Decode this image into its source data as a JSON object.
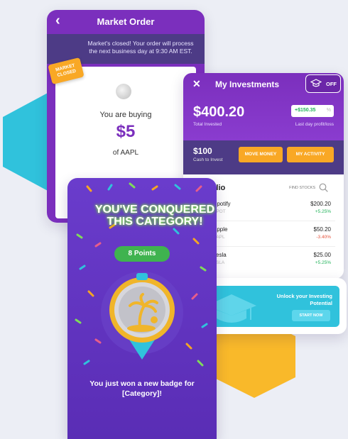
{
  "colors": {
    "purple": "#7b2fbd",
    "deep_purple": "#4d3b86",
    "yellow": "#f9a825",
    "teal": "#30c2dc",
    "green": "#3fb34f",
    "positive": "#21b35a",
    "negative": "#e5533d"
  },
  "market_order": {
    "title": "Market Order",
    "back_icon": "chevron-left-icon",
    "notice": "Market's closed! Your order will process the next business day at 9:30 AM EST.",
    "badge": "MARKET CLOSED",
    "buying_label": "You are buying",
    "amount": "$5",
    "of_label": "of AAPL"
  },
  "investments": {
    "title": "My Investments",
    "close_icon": "close-icon",
    "toggle_icon": "graduation-cap-icon",
    "toggle_label": "OFF",
    "total_amount": "$400.20",
    "total_label": "Total Invested",
    "change_value": "+$150.35",
    "change_label": "Last day profit/loss",
    "cash_amount": "$100",
    "cash_label": "Cash to Invest",
    "move_money_label": "MOVE MONEY",
    "my_activity_label": "MY ACTIVITY",
    "portfolio_title": "Portfolio",
    "find_stocks_label": "FIND STOCKS",
    "stocks": [
      {
        "name": "Spotify",
        "ticker": "SPOT",
        "price": "$200.20",
        "change": "+5.25%",
        "positive": true
      },
      {
        "name": "Apple",
        "ticker": "AAPL",
        "price": "$50.20",
        "change": "-3.40%",
        "positive": false
      },
      {
        "name": "Tesla",
        "ticker": "TSLA",
        "price": "$25.00",
        "change": "+5.25%",
        "positive": true
      }
    ]
  },
  "unlock": {
    "text_line1": "Unlock your Investing",
    "text_line2": "Potential",
    "button_label": "START NOW",
    "icon": "graduation-cap-icon"
  },
  "conquer": {
    "title_line1": "YOU'VE CONQUERED",
    "title_line2": "THIS CATEGORY!",
    "points": "8 Points",
    "medal_icon": "palm-tree-medal-icon",
    "message_line1": "You just won a new badge for",
    "message_line2": "[Category]!"
  }
}
